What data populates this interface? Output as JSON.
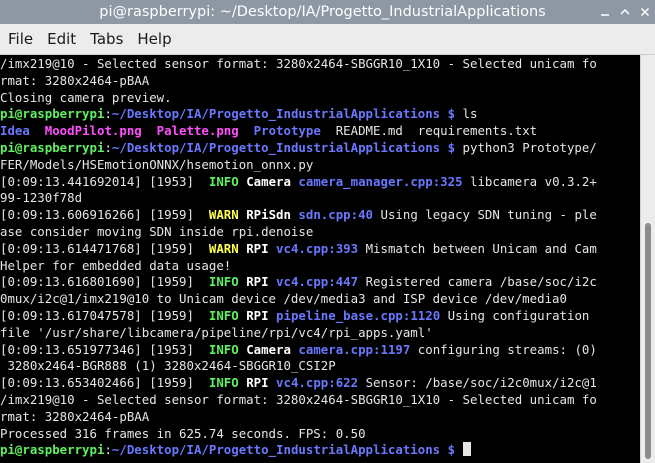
{
  "window": {
    "title": "pi@raspberrypi: ~/Desktop/IA/Progetto_IndustrialApplications"
  },
  "menu": [
    "File",
    "Edit",
    "Tabs",
    "Help"
  ],
  "icons": [
    "minimize-icon",
    "maximize-icon",
    "close-icon"
  ],
  "colors": {
    "titlebar": "#8e98a5",
    "prompt_user": "#5ff05f",
    "path_blue": "#6a78ff",
    "image_magenta": "#ff4fff",
    "info": "#5ff05f",
    "warn": "#ffff55"
  },
  "terminal": {
    "lines": [
      [
        {
          "t": "/imx219@10 - Selected sensor format: 3280x2464-SBGGR10_1X10 - Selected unicam fo",
          "c": ""
        }
      ],
      [
        {
          "t": "rmat: 3280x2464-pBAA",
          "c": ""
        }
      ],
      [
        {
          "t": "Closing camera preview.",
          "c": ""
        }
      ],
      [
        {
          "t": "pi@raspberrypi",
          "c": "prompt-user"
        },
        {
          "t": ":",
          "c": ""
        },
        {
          "t": "~/Desktop/IA/Progetto_IndustrialApplications $",
          "c": "prompt-path"
        },
        {
          "t": " ls",
          "c": ""
        }
      ],
      [
        {
          "t": "Idea",
          "c": "ls-dir"
        },
        {
          "t": "  ",
          "c": ""
        },
        {
          "t": "MoodPilot.png",
          "c": "ls-img"
        },
        {
          "t": "  ",
          "c": ""
        },
        {
          "t": "Palette.png",
          "c": "ls-img"
        },
        {
          "t": "  ",
          "c": ""
        },
        {
          "t": "Prototype",
          "c": "ls-dir"
        },
        {
          "t": "  README.md  requirements.txt",
          "c": ""
        }
      ],
      [
        {
          "t": "pi@raspberrypi",
          "c": "prompt-user"
        },
        {
          "t": ":",
          "c": ""
        },
        {
          "t": "~/Desktop/IA/Progetto_IndustrialApplications $",
          "c": "prompt-path"
        },
        {
          "t": " python3 Prototype/",
          "c": ""
        }
      ],
      [
        {
          "t": "FER/Models/HSEmotionONNX/hsemotion_onnx.py",
          "c": ""
        }
      ],
      [
        {
          "t": "[0:09:13.441692014] [1953]  ",
          "c": ""
        },
        {
          "t": "INFO",
          "c": "lvl-info"
        },
        {
          "t": " ",
          "c": ""
        },
        {
          "t": "Camera",
          "c": "cat"
        },
        {
          "t": " ",
          "c": ""
        },
        {
          "t": "camera_manager.cpp:325",
          "c": "src"
        },
        {
          "t": " libcamera v0.3.2+",
          "c": ""
        }
      ],
      [
        {
          "t": "99-1230f78d",
          "c": ""
        }
      ],
      [
        {
          "t": "[0:09:13.606916266] [1959]  ",
          "c": ""
        },
        {
          "t": "WARN",
          "c": "lvl-warn"
        },
        {
          "t": " ",
          "c": ""
        },
        {
          "t": "RPiSdn",
          "c": "cat"
        },
        {
          "t": " ",
          "c": ""
        },
        {
          "t": "sdn.cpp:40",
          "c": "src"
        },
        {
          "t": " Using legacy SDN tuning - ple",
          "c": ""
        }
      ],
      [
        {
          "t": "ase consider moving SDN inside rpi.denoise",
          "c": ""
        }
      ],
      [
        {
          "t": "[0:09:13.614471768] [1959]  ",
          "c": ""
        },
        {
          "t": "WARN",
          "c": "lvl-warn"
        },
        {
          "t": " ",
          "c": ""
        },
        {
          "t": "RPI",
          "c": "cat"
        },
        {
          "t": " ",
          "c": ""
        },
        {
          "t": "vc4.cpp:393",
          "c": "src"
        },
        {
          "t": " Mismatch between Unicam and Cam",
          "c": ""
        }
      ],
      [
        {
          "t": "Helper for embedded data usage!",
          "c": ""
        }
      ],
      [
        {
          "t": "[0:09:13.616801690] [1959]  ",
          "c": ""
        },
        {
          "t": "INFO",
          "c": "lvl-info"
        },
        {
          "t": " ",
          "c": ""
        },
        {
          "t": "RPI",
          "c": "cat"
        },
        {
          "t": " ",
          "c": ""
        },
        {
          "t": "vc4.cpp:447",
          "c": "src"
        },
        {
          "t": " Registered camera /base/soc/i2c",
          "c": ""
        }
      ],
      [
        {
          "t": "0mux/i2c@1/imx219@10 to Unicam device /dev/media3 and ISP device /dev/media0",
          "c": ""
        }
      ],
      [
        {
          "t": "[0:09:13.617047578] [1959]  ",
          "c": ""
        },
        {
          "t": "INFO",
          "c": "lvl-info"
        },
        {
          "t": " ",
          "c": ""
        },
        {
          "t": "RPI",
          "c": "cat"
        },
        {
          "t": " ",
          "c": ""
        },
        {
          "t": "pipeline_base.cpp:1120",
          "c": "src"
        },
        {
          "t": " Using configuration",
          "c": ""
        }
      ],
      [
        {
          "t": "file '/usr/share/libcamera/pipeline/rpi/vc4/rpi_apps.yaml'",
          "c": ""
        }
      ],
      [
        {
          "t": "[0:09:13.651977346] [1953]  ",
          "c": ""
        },
        {
          "t": "INFO",
          "c": "lvl-info"
        },
        {
          "t": " ",
          "c": ""
        },
        {
          "t": "Camera",
          "c": "cat"
        },
        {
          "t": " ",
          "c": ""
        },
        {
          "t": "camera.cpp:1197",
          "c": "src"
        },
        {
          "t": " configuring streams: (0)",
          "c": ""
        }
      ],
      [
        {
          "t": " 3280x2464-BGR888 (1) 3280x2464-SBGGR10_CSI2P",
          "c": ""
        }
      ],
      [
        {
          "t": "[0:09:13.653402466] [1959]  ",
          "c": ""
        },
        {
          "t": "INFO",
          "c": "lvl-info"
        },
        {
          "t": " ",
          "c": ""
        },
        {
          "t": "RPI",
          "c": "cat"
        },
        {
          "t": " ",
          "c": ""
        },
        {
          "t": "vc4.cpp:622",
          "c": "src"
        },
        {
          "t": " Sensor: /base/soc/i2c0mux/i2c@1",
          "c": ""
        }
      ],
      [
        {
          "t": "/imx219@10 - Selected sensor format: 3280x2464-SBGGR10_1X10 - Selected unicam fo",
          "c": ""
        }
      ],
      [
        {
          "t": "rmat: 3280x2464-pBAA",
          "c": ""
        }
      ],
      [
        {
          "t": "Processed 316 frames in 625.74 seconds. FPS: 0.50",
          "c": ""
        }
      ],
      [
        {
          "t": "pi@raspberrypi",
          "c": "prompt-user"
        },
        {
          "t": ":",
          "c": ""
        },
        {
          "t": "~/Desktop/IA/Progetto_IndustrialApplications $",
          "c": "prompt-path"
        },
        {
          "t": " ",
          "c": ""
        }
      ]
    ]
  }
}
